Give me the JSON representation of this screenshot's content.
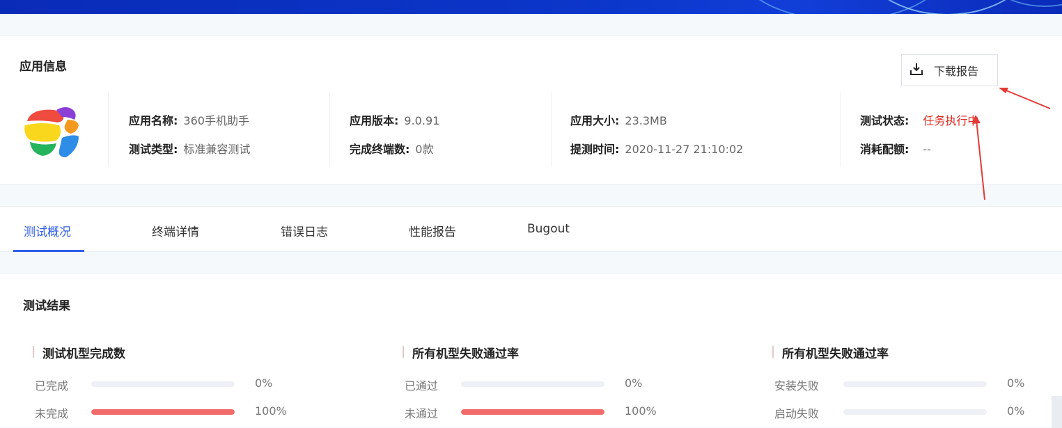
{
  "app_info": {
    "section_title": "应用信息",
    "download_label": "下载报告",
    "fields": {
      "app_name": {
        "key": "应用名称:",
        "value": "360手机助手"
      },
      "test_type": {
        "key": "测试类型:",
        "value": "标准兼容测试"
      },
      "app_version": {
        "key": "应用版本:",
        "value": "9.0.91"
      },
      "finished_devices": {
        "key": "完成终端数:",
        "value": "0款"
      },
      "app_size": {
        "key": "应用大小:",
        "value": "23.3MB"
      },
      "submit_time": {
        "key": "提测时间:",
        "value": "2020-11-27 21:10:02"
      },
      "test_status": {
        "key": "测试状态:",
        "value": "任务执行中"
      },
      "quota_used": {
        "key": "消耗配额:",
        "value": "--"
      }
    },
    "status_color": "#e0261b"
  },
  "tabs": [
    "测试概况",
    "终端详情",
    "错误日志",
    "性能报告",
    "Bugout"
  ],
  "active_tab": 0,
  "accent_color": "#2f5ee8",
  "results": {
    "section_title": "测试结果",
    "groups": [
      {
        "title": "测试机型完成数",
        "rows": [
          {
            "label": "已完成",
            "percent_text": "0%",
            "fill": 0
          },
          {
            "label": "未完成",
            "percent_text": "100%",
            "fill": 1
          }
        ]
      },
      {
        "title": "所有机型失败通过率",
        "rows": [
          {
            "label": "已通过",
            "percent_text": "0%",
            "fill": 0
          },
          {
            "label": "未通过",
            "percent_text": "100%",
            "fill": 1
          }
        ]
      },
      {
        "title": "所有机型失败通过率",
        "rows": [
          {
            "label": "安装失败",
            "percent_text": "0%",
            "fill": 0
          },
          {
            "label": "启动失败",
            "percent_text": "0%",
            "fill": 0
          }
        ]
      }
    ],
    "bar_color": "#f36a6a"
  }
}
